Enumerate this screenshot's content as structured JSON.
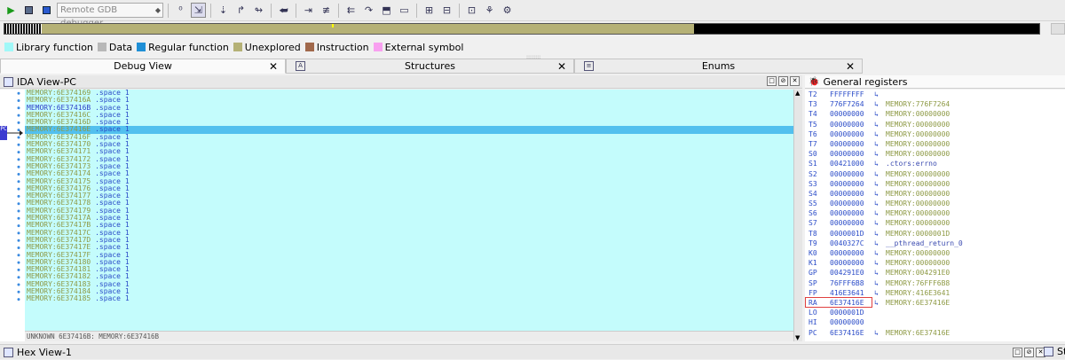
{
  "toolbar": {
    "debugger_select": "Remote GDB debugger"
  },
  "legend": [
    {
      "label": "Library function",
      "color": "#a0f8f8"
    },
    {
      "label": "Data",
      "color": "#b8b8b8"
    },
    {
      "label": "Regular function",
      "color": "#1f8fd6"
    },
    {
      "label": "Unexplored",
      "color": "#b5b176"
    },
    {
      "label": "Instruction",
      "color": "#a0684b"
    },
    {
      "label": "External symbol",
      "color": "#f8a0f0"
    }
  ],
  "tabs": [
    {
      "label": "Debug View",
      "close": "✕"
    },
    {
      "label": "Structures",
      "close": "✕"
    },
    {
      "label": "Enums",
      "close": "✕"
    }
  ],
  "ida_view": {
    "title": "IDA View-PC",
    "pc_marker": "PC",
    "lines": [
      {
        "addr": "MEMORY:6E374169",
        "op": ".space",
        "arg": "1"
      },
      {
        "addr": "MEMORY:6E37416A",
        "op": ".space",
        "arg": "1"
      },
      {
        "addr": "MEMORY:6E37416B",
        "op": ".space",
        "arg": "1"
      },
      {
        "addr": "MEMORY:6E37416C",
        "op": ".space",
        "arg": "1"
      },
      {
        "addr": "MEMORY:6E37416D",
        "op": ".space",
        "arg": "1"
      },
      {
        "addr": "MEMORY:6E37416E",
        "op": ".space",
        "arg": "1"
      },
      {
        "addr": "MEMORY:6E37416F",
        "op": ".space",
        "arg": "1"
      },
      {
        "addr": "MEMORY:6E374170",
        "op": ".space",
        "arg": "1"
      },
      {
        "addr": "MEMORY:6E374171",
        "op": ".space",
        "arg": "1"
      },
      {
        "addr": "MEMORY:6E374172",
        "op": ".space",
        "arg": "1"
      },
      {
        "addr": "MEMORY:6E374173",
        "op": ".space",
        "arg": "1"
      },
      {
        "addr": "MEMORY:6E374174",
        "op": ".space",
        "arg": "1"
      },
      {
        "addr": "MEMORY:6E374175",
        "op": ".space",
        "arg": "1"
      },
      {
        "addr": "MEMORY:6E374176",
        "op": ".space",
        "arg": "1"
      },
      {
        "addr": "MEMORY:6E374177",
        "op": ".space",
        "arg": "1"
      },
      {
        "addr": "MEMORY:6E374178",
        "op": ".space",
        "arg": "1"
      },
      {
        "addr": "MEMORY:6E374179",
        "op": ".space",
        "arg": "1"
      },
      {
        "addr": "MEMORY:6E37417A",
        "op": ".space",
        "arg": "1"
      },
      {
        "addr": "MEMORY:6E37417B",
        "op": ".space",
        "arg": "1"
      },
      {
        "addr": "MEMORY:6E37417C",
        "op": ".space",
        "arg": "1"
      },
      {
        "addr": "MEMORY:6E37417D",
        "op": ".space",
        "arg": "1"
      },
      {
        "addr": "MEMORY:6E37417E",
        "op": ".space",
        "arg": "1"
      },
      {
        "addr": "MEMORY:6E37417F",
        "op": ".space",
        "arg": "1"
      },
      {
        "addr": "MEMORY:6E374180",
        "op": ".space",
        "arg": "1"
      },
      {
        "addr": "MEMORY:6E374181",
        "op": ".space",
        "arg": "1"
      },
      {
        "addr": "MEMORY:6E374182",
        "op": ".space",
        "arg": "1"
      },
      {
        "addr": "MEMORY:6E374183",
        "op": ".space",
        "arg": "1"
      },
      {
        "addr": "MEMORY:6E374184",
        "op": ".space",
        "arg": "1"
      },
      {
        "addr": "MEMORY:6E374185",
        "op": ".space",
        "arg": "1"
      }
    ],
    "status": "UNKNOWN 6E37416B: MEMORY:6E37416B"
  },
  "registers": {
    "title": "General registers",
    "rows": [
      {
        "name": "T2",
        "value": "FFFFFFFF",
        "target": ""
      },
      {
        "name": "T3",
        "value": "776F7264",
        "target": "MEMORY:776F7264"
      },
      {
        "name": "T4",
        "value": "00000000",
        "target": "MEMORY:00000000"
      },
      {
        "name": "T5",
        "value": "00000000",
        "target": "MEMORY:00000000"
      },
      {
        "name": "T6",
        "value": "00000000",
        "target": "MEMORY:00000000"
      },
      {
        "name": "T7",
        "value": "00000000",
        "target": "MEMORY:00000000"
      },
      {
        "name": "S0",
        "value": "00000000",
        "target": "MEMORY:00000000"
      },
      {
        "name": "S1",
        "value": "00421000",
        "target": ".ctors:errno"
      },
      {
        "name": "S2",
        "value": "00000000",
        "target": "MEMORY:00000000"
      },
      {
        "name": "S3",
        "value": "00000000",
        "target": "MEMORY:00000000"
      },
      {
        "name": "S4",
        "value": "00000000",
        "target": "MEMORY:00000000"
      },
      {
        "name": "S5",
        "value": "00000000",
        "target": "MEMORY:00000000"
      },
      {
        "name": "S6",
        "value": "00000000",
        "target": "MEMORY:00000000"
      },
      {
        "name": "S7",
        "value": "00000000",
        "target": "MEMORY:00000000"
      },
      {
        "name": "T8",
        "value": "0000001D",
        "target": "MEMORY:0000001D"
      },
      {
        "name": "T9",
        "value": "0040327C",
        "target": "__pthread_return_0"
      },
      {
        "name": "K0",
        "value": "00000000",
        "target": "MEMORY:00000000"
      },
      {
        "name": "K1",
        "value": "00000000",
        "target": "MEMORY:00000000"
      },
      {
        "name": "GP",
        "value": "004291E0",
        "target": "MEMORY:004291E0"
      },
      {
        "name": "SP",
        "value": "76FFF6B8",
        "target": "MEMORY:76FFF6B8"
      },
      {
        "name": "FP",
        "value": "416E3641",
        "target": "MEMORY:416E3641"
      },
      {
        "name": "RA",
        "value": "6E37416E",
        "target": "MEMORY:6E37416E"
      },
      {
        "name": "LO",
        "value": "0000001D",
        "target": ""
      },
      {
        "name": "HI",
        "value": "00000000",
        "target": ""
      },
      {
        "name": "PC",
        "value": "6E37416E",
        "target": "MEMORY:6E37416E"
      }
    ]
  },
  "hex_view": {
    "title": "Hex View-1",
    "right_label": "Sta"
  }
}
